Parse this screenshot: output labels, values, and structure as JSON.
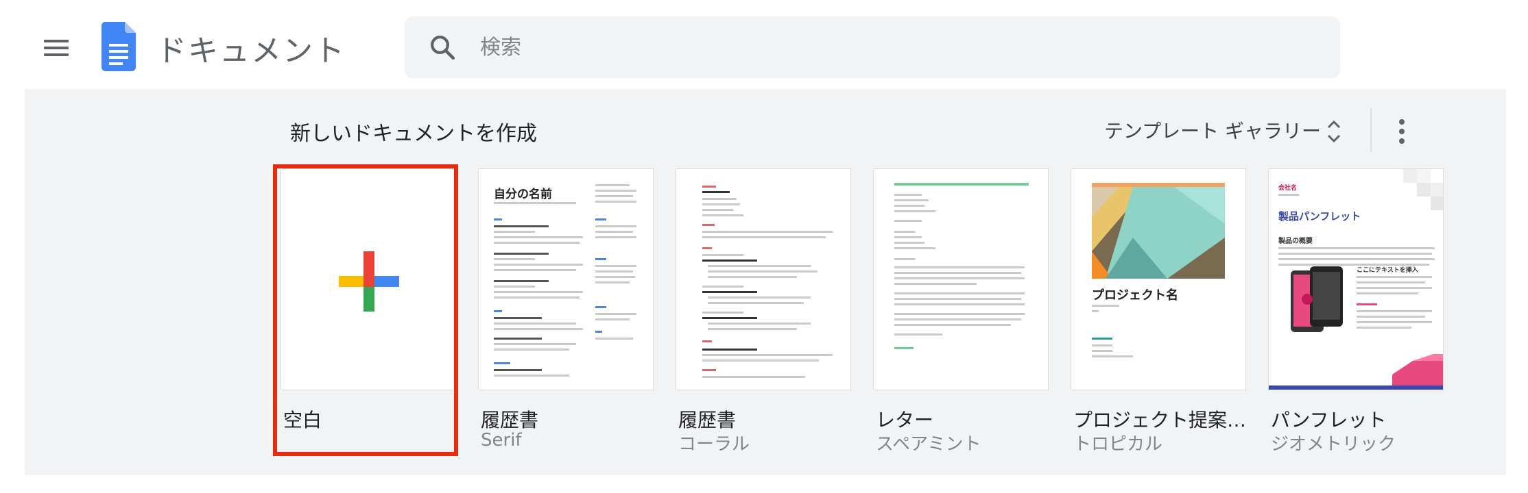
{
  "header": {
    "menu_icon": "hamburger-menu-icon",
    "logo_icon": "google-docs-icon",
    "app_title": "ドキュメント",
    "search": {
      "placeholder": "検索",
      "value": "",
      "icon": "search-icon"
    }
  },
  "gallery": {
    "section_title": "新しいドキュメントを作成",
    "gallery_toggle_label": "テンプレート ギャラリー",
    "toggle_icon": "unfold-icon",
    "more_icon": "more-vert-icon",
    "highlight_color": "#e52b10",
    "templates": [
      {
        "title": "空白",
        "subtitle": ""
      },
      {
        "title": "履歴書",
        "subtitle": "Serif",
        "thumb_heading": "自分の名前"
      },
      {
        "title": "履歴書",
        "subtitle": "コーラル"
      },
      {
        "title": "レター",
        "subtitle": "スペアミント"
      },
      {
        "title": "プロジェクト提案…",
        "subtitle": "トロピカル",
        "thumb_heading": "プロジェクト名"
      },
      {
        "title": "パンフレット",
        "subtitle": "ジオメトリック",
        "thumb_company": "会社名",
        "thumb_heading": "製品パンフレット",
        "thumb_section": "製品の概要",
        "thumb_text": "ここにテキストを挿入"
      }
    ]
  }
}
